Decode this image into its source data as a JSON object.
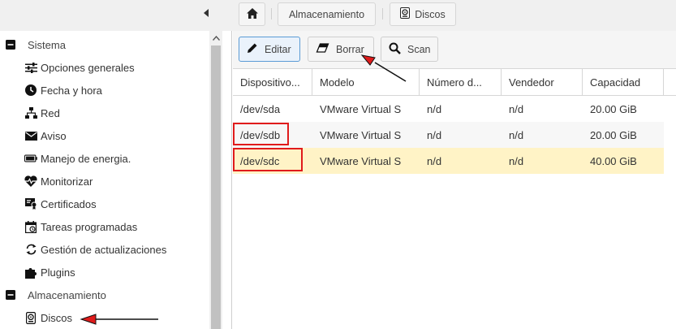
{
  "breadcrumb": {
    "home_icon": "home-icon",
    "items": [
      "Almacenamiento",
      "Discos"
    ]
  },
  "sidebar": {
    "groups": [
      {
        "label": "Sistema",
        "items": [
          {
            "label": "Opciones generales",
            "icon": "sliders-icon"
          },
          {
            "label": "Fecha y hora",
            "icon": "clock-icon"
          },
          {
            "label": "Red",
            "icon": "network-icon"
          },
          {
            "label": "Aviso",
            "icon": "envelope-icon"
          },
          {
            "label": "Manejo de energia.",
            "icon": "battery-icon"
          },
          {
            "label": "Monitorizar",
            "icon": "heartbeat-icon"
          },
          {
            "label": "Certificados",
            "icon": "certificate-icon"
          },
          {
            "label": "Tareas programadas",
            "icon": "calendar-icon"
          },
          {
            "label": "Gestión de actualizaciones",
            "icon": "refresh-icon"
          },
          {
            "label": "Plugins",
            "icon": "puzzle-icon"
          }
        ]
      },
      {
        "label": "Almacenamiento",
        "items": [
          {
            "label": "Discos",
            "icon": "harddisk-icon"
          }
        ]
      }
    ]
  },
  "toolbar": {
    "edit_label": "Editar",
    "delete_label": "Borrar",
    "scan_label": "Scan"
  },
  "table": {
    "columns": [
      "Dispositivo...",
      "Modelo",
      "Número d...",
      "Vendedor",
      "Capacidad"
    ],
    "rows": [
      [
        "/dev/sda",
        "VMware Virtual S",
        "n/d",
        "n/d",
        "20.00 GiB"
      ],
      [
        "/dev/sdb",
        "VMware Virtual S",
        "n/d",
        "n/d",
        "20.00 GiB"
      ],
      [
        "/dev/sdc",
        "VMware Virtual S",
        "n/d",
        "n/d",
        "40.00 GiB"
      ]
    ],
    "selected_row": 2
  },
  "colors": {
    "selected_row": "#fff3c6",
    "annotation_red": "#e01b1b",
    "active_button_border": "#5b9bd5"
  }
}
